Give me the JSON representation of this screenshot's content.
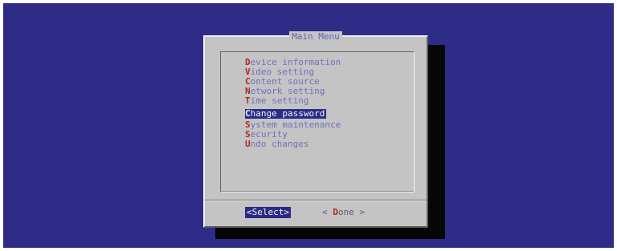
{
  "dialog": {
    "title": "Main Menu"
  },
  "menu": {
    "items": [
      {
        "hotkey": "D",
        "rest": "evice information",
        "selected": false
      },
      {
        "hotkey": "V",
        "rest": "ideo setting",
        "selected": false
      },
      {
        "hotkey": "C",
        "rest": "ontent source",
        "selected": false
      },
      {
        "hotkey": "N",
        "rest": "etwork setting",
        "selected": false
      },
      {
        "hotkey": "T",
        "rest": "ime setting",
        "selected": false
      },
      {
        "hotkey": "C",
        "rest": "hange password",
        "selected": true
      },
      {
        "hotkey": "S",
        "rest": "ystem maintenance",
        "selected": false
      },
      {
        "hotkey": "S",
        "rest": "ecurity",
        "selected": false
      },
      {
        "hotkey": "U",
        "rest": "ndo changes",
        "selected": false
      }
    ]
  },
  "buttons": {
    "select_label": "<Select>",
    "done_prefix": "< ",
    "done_hotkey": "D",
    "done_rest": "one >"
  },
  "colors": {
    "screen_background": "#2e2c86",
    "dialog_background": "#c4c4c4",
    "item_text": "#6f6fbf",
    "hotkey": "#b0271d",
    "selection_background": "#2b2b86",
    "selection_text": "#f3f3ff"
  }
}
